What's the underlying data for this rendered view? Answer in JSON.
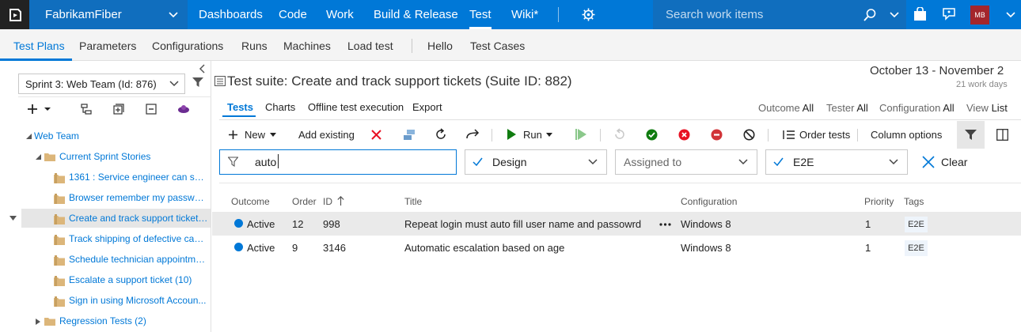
{
  "topbar": {
    "project": "FabrikamFiber",
    "nav": [
      "Dashboards",
      "Code",
      "Work",
      "Build & Release",
      "Test",
      "Wiki*"
    ],
    "search_placeholder": "Search work items",
    "avatar_initials": "MB",
    "accent": "#0078d7"
  },
  "subnav": {
    "tabs": [
      "Test Plans",
      "Parameters",
      "Configurations",
      "Runs",
      "Machines",
      "Load test",
      "Hello",
      "Test Cases"
    ],
    "active": "Test Plans"
  },
  "left": {
    "plan_select": "Sprint 3: Web Team (Id: 876)",
    "tree": [
      {
        "label": "Web Team",
        "level": 0,
        "expanded": true
      },
      {
        "label": "Current Sprint Stories",
        "level": 1,
        "expanded": true
      },
      {
        "label": "1361 : Service engineer can sup...",
        "level": 2
      },
      {
        "label": "Browser remember my passwor...",
        "level": 2
      },
      {
        "label": "Create and track support tickets...",
        "level": 2,
        "selected": true
      },
      {
        "label": "Track shipping of defective cabl...",
        "level": 2
      },
      {
        "label": "Schedule technician appointme...",
        "level": 2
      },
      {
        "label": "Escalate a support ticket (10)",
        "level": 2
      },
      {
        "label": "Sign in using Microsoft Accoun...",
        "level": 2
      },
      {
        "label": "Regression Tests (2)",
        "level": 1,
        "expanded": false
      }
    ]
  },
  "main": {
    "suite_title": "Test suite: Create and track support tickets (Suite ID: 882)",
    "date_range": "October 13 - November 2",
    "work_days": "21 work days",
    "pivots": [
      "Tests",
      "Charts",
      "Offline test execution",
      "Export"
    ],
    "filters": {
      "outcome_label": "Outcome",
      "outcome_value": "All",
      "tester_label": "Tester",
      "tester_value": "All",
      "configuration_label": "Configuration",
      "configuration_value": "All",
      "view_label": "View",
      "view_value": "List"
    },
    "toolbar": {
      "new": "New",
      "add_existing": "Add existing",
      "run": "Run",
      "order_tests": "Order tests",
      "column_options": "Column options"
    },
    "filterbar": {
      "keyword": "auto",
      "state": "Design",
      "assigned_placeholder": "Assigned to",
      "tag": "E2E",
      "clear": "Clear"
    },
    "columns": [
      "Outcome",
      "Order",
      "ID",
      "Title",
      "Configuration",
      "Priority",
      "Tags"
    ],
    "rows": [
      {
        "outcome": "Active",
        "order": "12",
        "id": "998",
        "title": "Repeat login must auto fill user name and passowrd",
        "configuration": "Windows 8",
        "priority": "1",
        "tag": "E2E"
      },
      {
        "outcome": "Active",
        "order": "9",
        "id": "3146",
        "title": "Automatic escalation based on age",
        "configuration": "Windows 8",
        "priority": "1",
        "tag": "E2E"
      }
    ],
    "status_colors": {
      "pass": "#107c10",
      "fail": "#e81123",
      "block": "#d13438",
      "active": "#0078d7"
    }
  }
}
